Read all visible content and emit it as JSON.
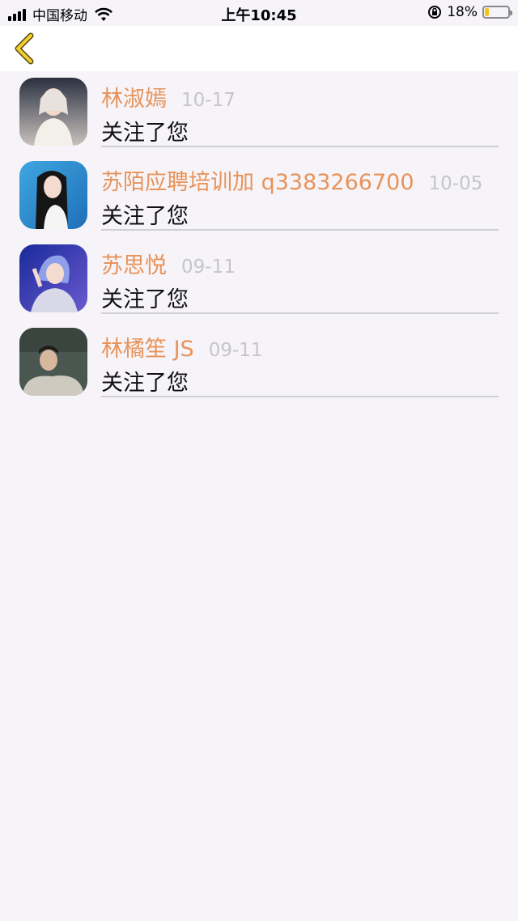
{
  "status_bar": {
    "carrier": "中国移动",
    "time": "上午10:45",
    "battery_percent": "18%",
    "battery_level": 0.18,
    "battery_color": "#f0c419"
  },
  "nav": {
    "back_icon": "chevron-left-icon",
    "accent": "#f0d030"
  },
  "notifications": [
    {
      "name": "林淑嫣",
      "time": "10-17",
      "message": "关注了您"
    },
    {
      "name": "苏陌应聘培训加 q3383266700",
      "time": "10-05",
      "message": "关注了您"
    },
    {
      "name": "苏思悦",
      "time": "09-11",
      "message": "关注了您"
    },
    {
      "name": "林橘笙 JS",
      "time": "09-11",
      "message": "关注了您"
    }
  ],
  "colors": {
    "name": "#e8935a",
    "time": "#c6c6c6",
    "background": "#f6f4f8"
  }
}
